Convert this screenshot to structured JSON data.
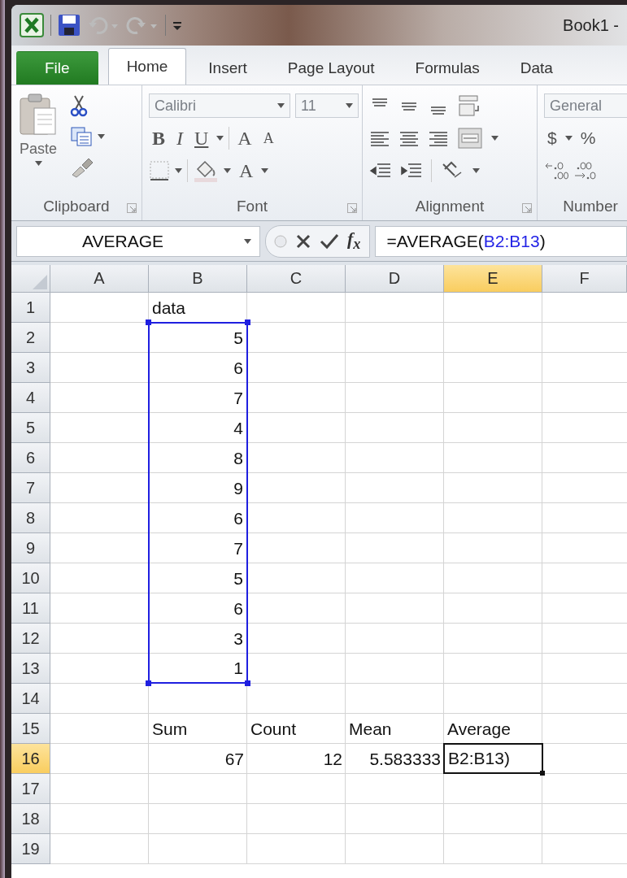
{
  "window": {
    "title": "Book1 -"
  },
  "tabs": [
    {
      "label": "File",
      "kind": "file",
      "selected": false
    },
    {
      "label": "Home",
      "kind": "tab",
      "selected": true
    },
    {
      "label": "Insert",
      "kind": "tab",
      "selected": false
    },
    {
      "label": "Page Layout",
      "kind": "tab",
      "selected": false
    },
    {
      "label": "Formulas",
      "kind": "tab",
      "selected": false
    },
    {
      "label": "Data",
      "kind": "tab",
      "selected": false
    }
  ],
  "ribbon": {
    "clipboard": {
      "label": "Clipboard",
      "paste": "Paste"
    },
    "font": {
      "label": "Font",
      "name": "Calibri",
      "size": "11",
      "bold": "B",
      "italic": "I",
      "underline": "U",
      "grow": "A",
      "shrink": "A",
      "font_color_button": "A"
    },
    "alignment": {
      "label": "Alignment"
    },
    "number": {
      "label": "Number",
      "format": "General",
      "currency": "$",
      "percent": "%"
    }
  },
  "formula_bar": {
    "name_box": "AVERAGE",
    "fx_label": "f$_{x}$",
    "formula": [
      {
        "text": "=AVERAGE(",
        "kind": "plain"
      },
      {
        "text": "B2:B13",
        "kind": "ref"
      },
      {
        "text": ")",
        "kind": "plain"
      }
    ]
  },
  "sheet": {
    "columns": [
      {
        "label": "A",
        "selected": false
      },
      {
        "label": "B",
        "selected": false
      },
      {
        "label": "C",
        "selected": false
      },
      {
        "label": "D",
        "selected": false
      },
      {
        "label": "E",
        "selected": true
      },
      {
        "label": "F",
        "selected": false
      }
    ],
    "rows": [
      {
        "number": "1",
        "selected": false,
        "cells": [
          null,
          {
            "text": "data",
            "kind": "text",
            "highlighted": false,
            "active": false
          },
          null,
          null,
          null,
          null
        ]
      },
      {
        "number": "2",
        "selected": false,
        "cells": [
          null,
          {
            "text": "5",
            "kind": "number",
            "highlighted": true,
            "active": false
          },
          null,
          null,
          null,
          null
        ]
      },
      {
        "number": "3",
        "selected": false,
        "cells": [
          null,
          {
            "text": "6",
            "kind": "number",
            "highlighted": true,
            "active": false
          },
          null,
          null,
          null,
          null
        ]
      },
      {
        "number": "4",
        "selected": false,
        "cells": [
          null,
          {
            "text": "7",
            "kind": "number",
            "highlighted": true,
            "active": false
          },
          null,
          null,
          null,
          null
        ]
      },
      {
        "number": "5",
        "selected": false,
        "cells": [
          null,
          {
            "text": "4",
            "kind": "number",
            "highlighted": true,
            "active": false
          },
          null,
          null,
          null,
          null
        ]
      },
      {
        "number": "6",
        "selected": false,
        "cells": [
          null,
          {
            "text": "8",
            "kind": "number",
            "highlighted": true,
            "active": false
          },
          null,
          null,
          null,
          null
        ]
      },
      {
        "number": "7",
        "selected": false,
        "cells": [
          null,
          {
            "text": "9",
            "kind": "number",
            "highlighted": true,
            "active": false
          },
          null,
          null,
          null,
          null
        ]
      },
      {
        "number": "8",
        "selected": false,
        "cells": [
          null,
          {
            "text": "6",
            "kind": "number",
            "highlighted": true,
            "active": false
          },
          null,
          null,
          null,
          null
        ]
      },
      {
        "number": "9",
        "selected": false,
        "cells": [
          null,
          {
            "text": "7",
            "kind": "number",
            "highlighted": true,
            "active": false
          },
          null,
          null,
          null,
          null
        ]
      },
      {
        "number": "10",
        "selected": false,
        "cells": [
          null,
          {
            "text": "5",
            "kind": "number",
            "highlighted": true,
            "active": false
          },
          null,
          null,
          null,
          null
        ]
      },
      {
        "number": "11",
        "selected": false,
        "cells": [
          null,
          {
            "text": "6",
            "kind": "number",
            "highlighted": true,
            "active": false
          },
          null,
          null,
          null,
          null
        ]
      },
      {
        "number": "12",
        "selected": false,
        "cells": [
          null,
          {
            "text": "3",
            "kind": "number",
            "highlighted": true,
            "active": false
          },
          null,
          null,
          null,
          null
        ]
      },
      {
        "number": "13",
        "selected": false,
        "cells": [
          null,
          {
            "text": "1",
            "kind": "number",
            "highlighted": true,
            "active": false
          },
          null,
          null,
          null,
          null
        ]
      },
      {
        "number": "14",
        "selected": false,
        "cells": [
          null,
          null,
          null,
          null,
          null,
          null
        ]
      },
      {
        "number": "15",
        "selected": false,
        "cells": [
          null,
          {
            "text": "Sum",
            "kind": "text",
            "highlighted": false,
            "active": false
          },
          {
            "text": "Count",
            "kind": "text",
            "highlighted": false,
            "active": false
          },
          {
            "text": "Mean",
            "kind": "text",
            "highlighted": false,
            "active": false
          },
          {
            "text": "Average",
            "kind": "text",
            "highlighted": false,
            "active": false
          },
          null
        ]
      },
      {
        "number": "16",
        "selected": true,
        "cells": [
          null,
          {
            "text": "67",
            "kind": "number",
            "highlighted": false,
            "active": false
          },
          {
            "text": "12",
            "kind": "number",
            "highlighted": false,
            "active": false
          },
          {
            "text": "5.583333",
            "kind": "number",
            "highlighted": false,
            "active": false
          },
          {
            "text": "B2:B13)",
            "kind": "text",
            "highlighted": false,
            "active": true
          },
          null
        ]
      },
      {
        "number": "17",
        "selected": false,
        "cells": [
          null,
          null,
          null,
          null,
          null,
          null
        ]
      },
      {
        "number": "18",
        "selected": false,
        "cells": [
          null,
          null,
          null,
          null,
          null,
          null
        ]
      },
      {
        "number": "19",
        "selected": false,
        "cells": [
          null,
          null,
          null,
          null,
          null,
          null
        ]
      }
    ]
  }
}
